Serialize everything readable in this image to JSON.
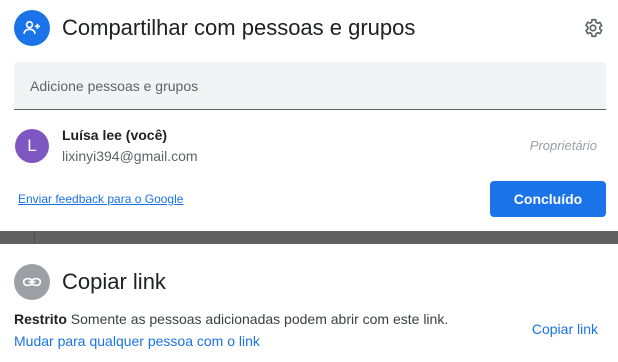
{
  "share": {
    "title": "Compartilhar com pessoas e grupos",
    "input_placeholder": "Adicione pessoas e grupos",
    "user": {
      "initial": "L",
      "name": "Luísa lee (você)",
      "email": "lixinyi394@gmail.com",
      "role": "Proprietário"
    },
    "feedback_link": "Enviar feedback para o Google",
    "done_button": "Concluído"
  },
  "link": {
    "title": "Copiar link",
    "restricted_label": "Restrito",
    "restricted_description": "Somente as pessoas adicionadas podem abrir com este link.",
    "change_link": "Mudar para qualquer pessoa com o link",
    "copy_button": "Copiar link"
  },
  "colors": {
    "accent": "#1a73e8",
    "user_avatar": "#7e57c2",
    "link_icon_bg": "#9aa0a6",
    "backdrop": "#616161"
  },
  "icons": {
    "share_header": "person-add-icon",
    "settings": "gear-icon",
    "link_header": "link-icon"
  }
}
